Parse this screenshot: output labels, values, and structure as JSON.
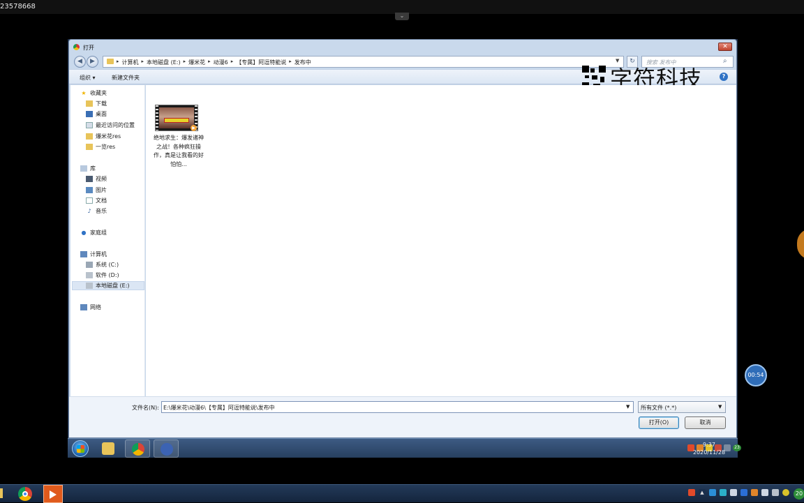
{
  "remote": {
    "session_id": "23578668",
    "expand_glyph": "⌄"
  },
  "dialog": {
    "title": "打开",
    "close_glyph": "✕",
    "breadcrumb": [
      "计算机",
      "本地磁盘 (E:)",
      "爆米花",
      "动漫6",
      "【专属】阿逗特能说",
      "发布中"
    ],
    "search_placeholder": "搜索 发布中",
    "toolbar": {
      "organize": "组织 ▾",
      "new_folder": "新建文件夹",
      "help": "?"
    },
    "watermark": "字符科技",
    "nav": {
      "favorites": "收藏夹",
      "downloads": "下载",
      "desktop": "桌面",
      "recent": "最近访问的位置",
      "popcorn_res": "爆米花res",
      "yilan_res": "一览res",
      "libraries": "库",
      "videos": "视频",
      "pictures": "图片",
      "documents": "文档",
      "music": "音乐",
      "homegroup": "家庭组",
      "computer": "计算机",
      "drive_c": "系统 (C:)",
      "drive_d": "软件 (D:)",
      "drive_e": "本地磁盘 (E:)",
      "network": "网络"
    },
    "file": {
      "name": "绝地求生：爆发诸神之战！各种疯狂操作，真是让我看的好怕怕...",
      "thumbnail_icon": "video-thumbnail-icon"
    },
    "filename_label": "文件名(N):",
    "filename_value": "E:\\爆米花\\动漫6\\【专属】阿逗特能说\\发布中",
    "filter_value": "所有文件 (*.*)",
    "open_label": "打开(O)",
    "cancel_label": "取消"
  },
  "inner_taskbar": {
    "clock_time": "9:37",
    "clock_date": "2020/11/28",
    "tray_badge": "23"
  },
  "outer_taskbar": {
    "clock_badge": "20"
  },
  "timer": {
    "value": "00:54"
  },
  "colors": {
    "accent": "#2f6db8",
    "dialog_frame": "#c9d9ec",
    "taskbar": "#27405f"
  }
}
